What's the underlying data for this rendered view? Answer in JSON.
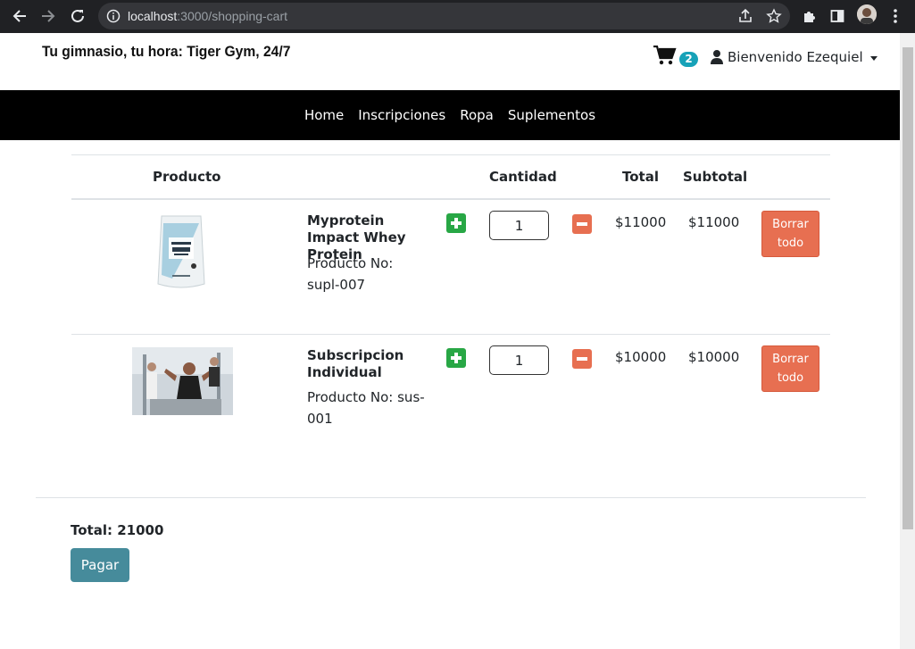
{
  "browser": {
    "url_host": "localhost",
    "url_path": ":3000/shopping-cart"
  },
  "header": {
    "brand": "Tu gimnasio, tu hora: Tiger Gym, 24/7",
    "cart_count": "2",
    "user_label": "Bienvenido Ezequiel"
  },
  "nav": {
    "items": [
      {
        "label": "Home"
      },
      {
        "label": "Inscripciones"
      },
      {
        "label": "Ropa"
      },
      {
        "label": "Suplementos"
      }
    ]
  },
  "table": {
    "headers": {
      "producto": "Producto",
      "cantidad": "Cantidad",
      "total": "Total",
      "subtotal": "Subtotal"
    },
    "rows": [
      {
        "name": "Myprotein Impact Whey Protein",
        "product_no": "Producto No: supl-007",
        "quantity": "1",
        "total": "$11000",
        "subtotal": "$11000",
        "delete_label": "Borrar todo"
      },
      {
        "name": "Subscripcion Individual",
        "product_no": "Producto No: sus-001",
        "quantity": "1",
        "total": "$10000",
        "subtotal": "$10000",
        "delete_label": "Borrar todo"
      }
    ]
  },
  "summary": {
    "total_label": "Total: 21000",
    "pay_label": "Pagar"
  },
  "colors": {
    "navbar": "#000000",
    "plus": "#28a745",
    "minus": "#e76f51",
    "pay": "#468b9b",
    "badge": "#17a2b8"
  }
}
